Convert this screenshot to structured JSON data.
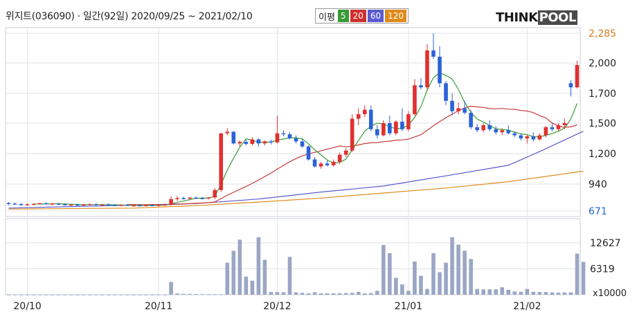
{
  "header": {
    "company": "위지트(036090)",
    "period": "일간(92일)",
    "date_range": "2020/09/25 ~ 2021/02/10",
    "ma_label": "이평",
    "ma_periods": [
      {
        "label": "5",
        "color": "#3a9a35"
      },
      {
        "label": "20",
        "color": "#d03030"
      },
      {
        "label": "60",
        "color": "#5a5ad0"
      },
      {
        "label": "120",
        "color": "#e08a1a"
      }
    ],
    "logo_left": "THINK",
    "logo_right": "POOL"
  },
  "colors": {
    "up": "#e03030",
    "down": "#2a62d8",
    "volume": "#9aa6c4",
    "grid": "#dfe3ea",
    "ma5": "#3a9a35",
    "ma20": "#c83a3a",
    "ma60": "#5a5ad0",
    "ma120": "#e08a1a"
  },
  "chart_data": {
    "type": "candlestick",
    "price_axis": {
      "ticks": [
        "2,285",
        "2,000",
        "1,700",
        "1,500",
        "1,200",
        "940",
        "671"
      ],
      "tick_values": [
        2285,
        2000,
        1700,
        1500,
        1200,
        940,
        671
      ],
      "highlight_colors": {
        "2,285": "#e07a1a",
        "671": "#2a62d8"
      }
    },
    "volume_axis": {
      "ticks": [
        "12627",
        "6319"
      ],
      "tick_values": [
        12627,
        6319
      ],
      "unit": "x10000"
    },
    "x_labels": [
      {
        "label": "20/10",
        "index": 3
      },
      {
        "label": "20/11",
        "index": 24
      },
      {
        "label": "20/12",
        "index": 43
      },
      {
        "label": "21/01",
        "index": 64
      },
      {
        "label": "21/02",
        "index": 83
      }
    ],
    "candles": [
      [
        750,
        760,
        730,
        745
      ],
      [
        745,
        755,
        735,
        740
      ],
      [
        740,
        750,
        725,
        735
      ],
      [
        735,
        745,
        725,
        738
      ],
      [
        738,
        748,
        730,
        742
      ],
      [
        742,
        755,
        735,
        748
      ],
      [
        748,
        760,
        738,
        740
      ],
      [
        740,
        752,
        732,
        745
      ],
      [
        745,
        755,
        730,
        738
      ],
      [
        738,
        748,
        725,
        732
      ],
      [
        732,
        742,
        722,
        735
      ],
      [
        735,
        745,
        725,
        728
      ],
      [
        728,
        740,
        720,
        736
      ],
      [
        736,
        748,
        728,
        740
      ],
      [
        740,
        750,
        728,
        732
      ],
      [
        732,
        742,
        722,
        735
      ],
      [
        735,
        748,
        725,
        730
      ],
      [
        730,
        740,
        720,
        726
      ],
      [
        726,
        738,
        718,
        732
      ],
      [
        732,
        742,
        722,
        725
      ],
      [
        725,
        735,
        715,
        728
      ],
      [
        728,
        740,
        720,
        724
      ],
      [
        724,
        735,
        716,
        730
      ],
      [
        730,
        742,
        722,
        726
      ],
      [
        726,
        738,
        718,
        732
      ],
      [
        732,
        742,
        722,
        735
      ],
      [
        735,
        820,
        725,
        790
      ],
      [
        790,
        820,
        770,
        800
      ],
      [
        800,
        815,
        785,
        795
      ],
      [
        795,
        810,
        780,
        805
      ],
      [
        805,
        815,
        790,
        800
      ],
      [
        800,
        812,
        788,
        798
      ],
      [
        798,
        810,
        785,
        806
      ],
      [
        806,
        900,
        790,
        880
      ],
      [
        880,
        1000,
        860,
        1400
      ],
      [
        1400,
        1450,
        1380,
        1415
      ],
      [
        1415,
        1420,
        1290,
        1300
      ],
      [
        1300,
        1330,
        1270,
        1315
      ],
      [
        1315,
        1340,
        1280,
        1295
      ],
      [
        1295,
        1360,
        1280,
        1340
      ],
      [
        1340,
        1350,
        1270,
        1300
      ],
      [
        1300,
        1330,
        1280,
        1320
      ],
      [
        1320,
        1340,
        1290,
        1310
      ],
      [
        1310,
        1550,
        1300,
        1400
      ],
      [
        1400,
        1430,
        1370,
        1390
      ],
      [
        1390,
        1410,
        1340,
        1350
      ],
      [
        1350,
        1380,
        1300,
        1320
      ],
      [
        1320,
        1340,
        1260,
        1270
      ],
      [
        1270,
        1280,
        1140,
        1150
      ],
      [
        1150,
        1170,
        1080,
        1090
      ],
      [
        1090,
        1130,
        1070,
        1115
      ],
      [
        1115,
        1140,
        1090,
        1100
      ],
      [
        1100,
        1150,
        1090,
        1130
      ],
      [
        1130,
        1210,
        1110,
        1190
      ],
      [
        1190,
        1250,
        1170,
        1230
      ],
      [
        1230,
        1560,
        1220,
        1530
      ],
      [
        1530,
        1600,
        1480,
        1560
      ],
      [
        1560,
        1620,
        1540,
        1590
      ],
      [
        1590,
        1620,
        1420,
        1440
      ],
      [
        1440,
        1480,
        1350,
        1380
      ],
      [
        1380,
        1520,
        1370,
        1500
      ],
      [
        1500,
        1550,
        1380,
        1400
      ],
      [
        1400,
        1520,
        1380,
        1510
      ],
      [
        1510,
        1600,
        1420,
        1440
      ],
      [
        1440,
        1580,
        1420,
        1560
      ],
      [
        1560,
        1840,
        1550,
        1780
      ],
      [
        1780,
        1850,
        1740,
        1760
      ],
      [
        1760,
        2180,
        1740,
        2120
      ],
      [
        2120,
        2285,
        2040,
        2060
      ],
      [
        2060,
        2160,
        1760,
        1800
      ],
      [
        1800,
        1820,
        1620,
        1650
      ],
      [
        1650,
        1700,
        1550,
        1580
      ],
      [
        1580,
        1640,
        1560,
        1600
      ],
      [
        1600,
        1650,
        1560,
        1570
      ],
      [
        1570,
        1590,
        1440,
        1460
      ],
      [
        1460,
        1490,
        1410,
        1430
      ],
      [
        1430,
        1500,
        1410,
        1480
      ],
      [
        1480,
        1520,
        1420,
        1440
      ],
      [
        1440,
        1470,
        1390,
        1410
      ],
      [
        1410,
        1450,
        1380,
        1430
      ],
      [
        1430,
        1480,
        1390,
        1400
      ],
      [
        1400,
        1420,
        1360,
        1380
      ],
      [
        1380,
        1400,
        1330,
        1350
      ],
      [
        1350,
        1390,
        1300,
        1370
      ],
      [
        1370,
        1410,
        1320,
        1340
      ],
      [
        1340,
        1400,
        1330,
        1380
      ],
      [
        1380,
        1470,
        1360,
        1460
      ],
      [
        1460,
        1500,
        1420,
        1440
      ],
      [
        1440,
        1500,
        1420,
        1480
      ],
      [
        1480,
        1530,
        1440,
        1500
      ],
      [
        1800,
        1830,
        1680,
        1760
      ],
      [
        1760,
        2020,
        1750,
        1980
      ]
    ],
    "volume": [
      40,
      40,
      40,
      40,
      40,
      40,
      40,
      40,
      40,
      40,
      40,
      40,
      40,
      40,
      40,
      40,
      40,
      40,
      40,
      40,
      40,
      40,
      40,
      40,
      40,
      40,
      3100,
      300,
      200,
      180,
      150,
      150,
      150,
      120,
      120,
      7800,
      10700,
      13400,
      4400,
      3400,
      14000,
      8500,
      650,
      650,
      600,
      9200,
      600,
      450,
      350,
      600,
      350,
      350,
      350,
      350,
      400,
      450,
      700,
      350,
      400,
      950,
      12100,
      10100,
      4100,
      2500,
      950,
      8100,
      4600,
      1400,
      10100,
      5500,
      7800,
      14000,
      12200,
      10700,
      8700,
      1400,
      1300,
      1300,
      1300,
      1800,
      1200,
      800,
      700,
      1400,
      700,
      650,
      650,
      550,
      500,
      550,
      550,
      10000,
      8000
    ],
    "ma5_start_index": 4,
    "ma20_start_index": 19,
    "ma60_points": [
      [
        0,
        700
      ],
      [
        30,
        745
      ],
      [
        40,
        790
      ],
      [
        50,
        860
      ],
      [
        60,
        920
      ],
      [
        70,
        1010
      ],
      [
        80,
        1100
      ],
      [
        85,
        1220
      ],
      [
        92,
        1420
      ]
    ],
    "ma120_points": [
      [
        0,
        690
      ],
      [
        20,
        700
      ],
      [
        30,
        725
      ],
      [
        40,
        760
      ],
      [
        50,
        800
      ],
      [
        60,
        850
      ],
      [
        70,
        900
      ],
      [
        80,
        960
      ],
      [
        92,
        1050
      ]
    ]
  }
}
